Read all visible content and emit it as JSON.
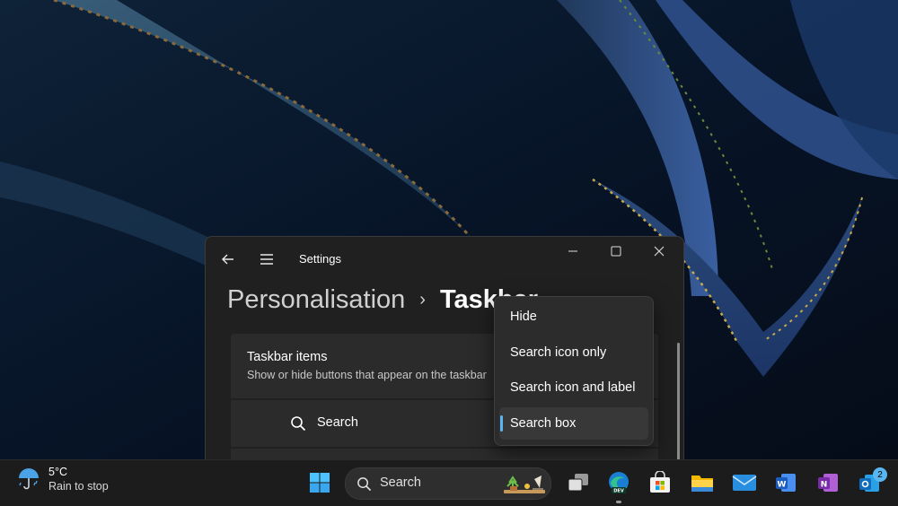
{
  "window": {
    "title": "Settings",
    "breadcrumb_parent": "Personalisation",
    "breadcrumb_separator": "›",
    "breadcrumb_current": "Taskbar"
  },
  "taskbar_items_card": {
    "title": "Taskbar items",
    "subtitle": "Show or hide buttons that appear on the taskbar"
  },
  "search_row": {
    "label": "Search"
  },
  "search_menu": {
    "options": [
      "Hide",
      "Search icon only",
      "Search icon and label",
      "Search box"
    ],
    "selected": "Search box",
    "accent": "#5ab6f0"
  },
  "taskbar": {
    "weather_temp": "5°C",
    "weather_desc": "Rain to stop",
    "search_label": "Search",
    "badge_count": "2",
    "icons": [
      "start-icon",
      "search-icon",
      "task-view-icon",
      "edge-dev-icon",
      "store-icon",
      "file-explorer-icon",
      "mail-icon",
      "word-icon",
      "onenote-icon",
      "outlook-icon"
    ]
  }
}
